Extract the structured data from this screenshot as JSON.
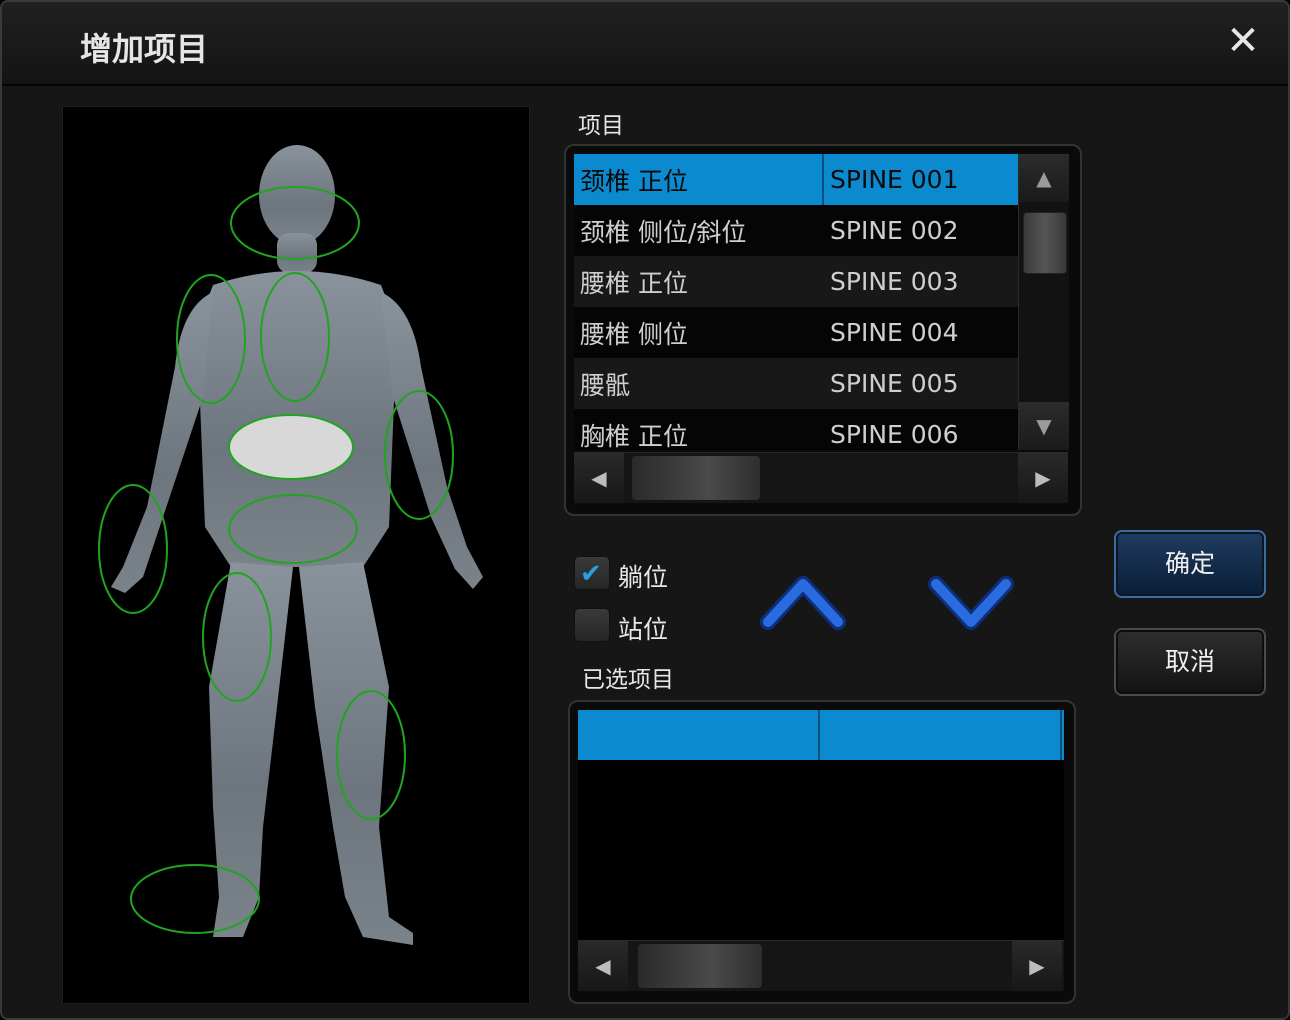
{
  "dialog": {
    "title": "增加项目",
    "close_glyph": "✕"
  },
  "items_label": "项目",
  "items": [
    {
      "name": "颈椎 正位",
      "code": "SPINE 001",
      "selected": true
    },
    {
      "name": "颈椎 侧位/斜位",
      "code": "SPINE 002",
      "selected": false
    },
    {
      "name": "腰椎 正位",
      "code": "SPINE 003",
      "selected": false
    },
    {
      "name": "腰椎 侧位",
      "code": "SPINE 004",
      "selected": false
    },
    {
      "name": "腰骶",
      "code": "SPINE 005",
      "selected": false
    },
    {
      "name": "胸椎 正位",
      "code": "SPINE 006",
      "selected": false
    }
  ],
  "scroll_glyphs": {
    "up": "▲",
    "down": "▼",
    "left": "◀",
    "right": "▶"
  },
  "positions": [
    {
      "label": "躺位",
      "checked": true
    },
    {
      "label": "站位",
      "checked": false
    }
  ],
  "check_glyph": "✔",
  "selected_label": "已选项目",
  "buttons": {
    "ok": "确定",
    "cancel": "取消"
  },
  "colors": {
    "selection": "#0b8ad0",
    "region_outline": "#1fa51f",
    "region_highlight": "#d8d8d8",
    "arrow_blue": "#1d5fd0"
  },
  "icons": {
    "move_up": "chevron-up-icon",
    "move_down": "chevron-down-icon",
    "close": "close-icon"
  }
}
